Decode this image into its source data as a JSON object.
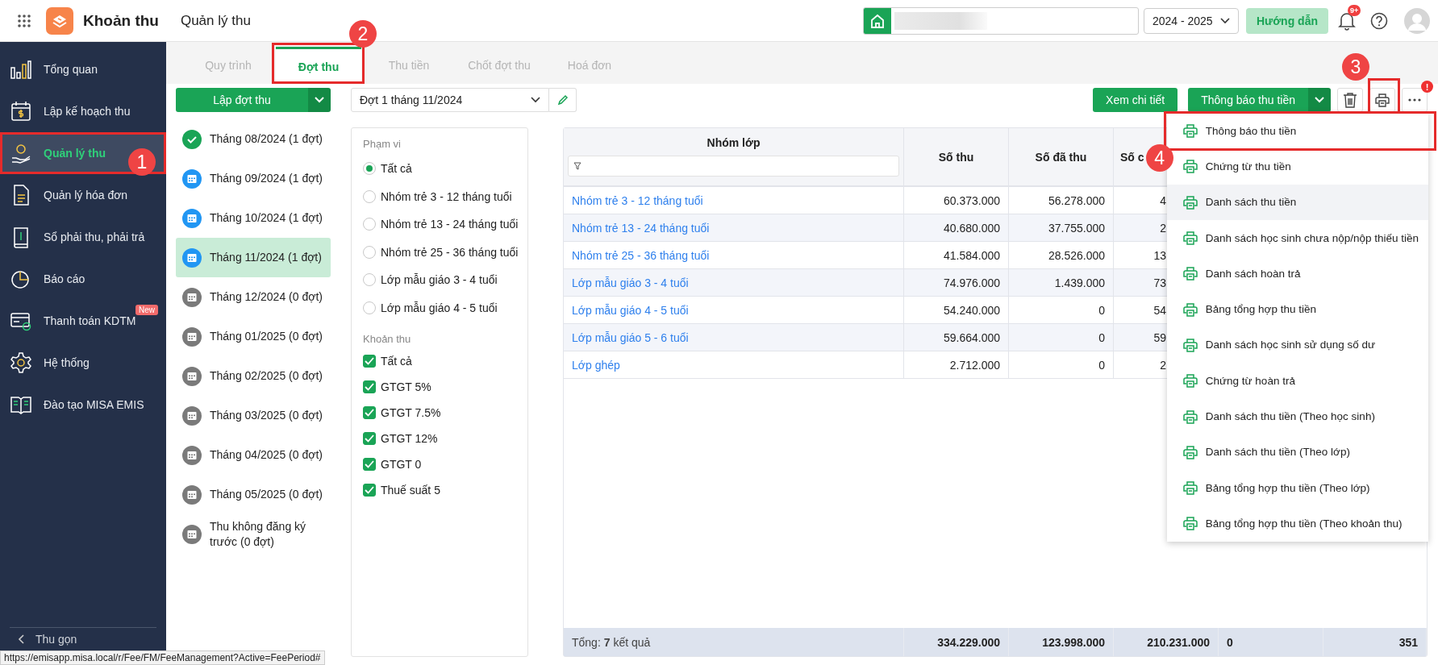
{
  "app": {
    "title": "Khoản thu",
    "page_title": "Quản lý thu"
  },
  "header": {
    "year": "2024 - 2025",
    "guide_button": "Hướng dẫn",
    "notification_badge": "9+"
  },
  "sidebar": {
    "items": [
      {
        "label": "Tổng quan",
        "kind": "chart",
        "selected": false
      },
      {
        "label": "Lập kế hoạch thu",
        "kind": "calendar",
        "selected": false
      },
      {
        "label": "Quản lý thu",
        "kind": "hand",
        "selected": true,
        "callout": "1"
      },
      {
        "label": "Quản lý hóa đơn",
        "kind": "document",
        "selected": false
      },
      {
        "label": "Sổ phải thu, phải trả",
        "kind": "ledger",
        "selected": false
      },
      {
        "label": "Báo cáo",
        "kind": "pie",
        "selected": false
      },
      {
        "label": "Thanh toán KDTM",
        "kind": "card",
        "selected": false,
        "badge": "New"
      },
      {
        "label": "Hệ thống",
        "kind": "gear",
        "selected": false
      },
      {
        "label": "Đào tạo MISA EMIS",
        "kind": "book",
        "selected": false
      }
    ],
    "collapse": "Thu gọn"
  },
  "tabs": [
    {
      "label": "Quy trình",
      "selected": false
    },
    {
      "label": "Đợt thu",
      "selected": true,
      "callout": "2"
    },
    {
      "label": "Thu tiền",
      "selected": false
    },
    {
      "label": "Chốt đợt thu",
      "selected": false
    },
    {
      "label": "Hoá đơn",
      "selected": false
    }
  ],
  "periods": {
    "create_button": "Lập đợt thu",
    "months": [
      {
        "label": "Tháng 08/2024 (1 đợt)",
        "kind": "done",
        "selected": false
      },
      {
        "label": "Tháng 09/2024 (1 đợt)",
        "kind": "scheduled",
        "selected": false
      },
      {
        "label": "Tháng 10/2024 (1 đợt)",
        "kind": "scheduled",
        "selected": false
      },
      {
        "label": "Tháng 11/2024 (1 đợt)",
        "kind": "scheduled",
        "selected": true
      },
      {
        "label": "Tháng 12/2024 (0 đợt)",
        "kind": "empty",
        "selected": false
      },
      {
        "label": "Tháng 01/2025 (0 đợt)",
        "kind": "empty",
        "selected": false
      },
      {
        "label": "Tháng 02/2025 (0 đợt)",
        "kind": "empty",
        "selected": false
      },
      {
        "label": "Tháng 03/2025 (0 đợt)",
        "kind": "empty",
        "selected": false
      },
      {
        "label": "Tháng 04/2025 (0 đợt)",
        "kind": "empty",
        "selected": false
      },
      {
        "label": "Tháng 05/2025 (0 đợt)",
        "kind": "empty",
        "selected": false
      },
      {
        "label": "Thu không đăng ký trước (0 đợt)",
        "kind": "empty",
        "selected": false
      }
    ]
  },
  "period_select": {
    "value": "Đợt 1 tháng 11/2024"
  },
  "actions": {
    "detail_button": "Xem chi tiết",
    "notify_button": "Thông báo thu tiền",
    "print_callout": "3",
    "more_alert": "!"
  },
  "filters": {
    "scope_label": "Phạm vi",
    "scope": [
      {
        "label": "Tất cả",
        "selected": true
      },
      {
        "label": "Nhóm trẻ 3 - 12 tháng tuổi",
        "selected": false
      },
      {
        "label": "Nhóm trẻ 13 - 24 tháng tuổi",
        "selected": false
      },
      {
        "label": "Nhóm trẻ 25 - 36 tháng tuổi",
        "selected": false
      },
      {
        "label": "Lớp mẫu giáo 3 - 4 tuổi",
        "selected": false
      },
      {
        "label": "Lớp mẫu giáo 4 - 5 tuổi",
        "selected": false
      }
    ],
    "fee_label": "Khoản thu",
    "fees": [
      {
        "label": "Tất cả",
        "checked": true
      },
      {
        "label": "GTGT 5%",
        "checked": true
      },
      {
        "label": "GTGT 7.5%",
        "checked": true
      },
      {
        "label": "GTGT 12%",
        "checked": true
      },
      {
        "label": "GTGT 0",
        "checked": true
      },
      {
        "label": "Thuế suất 5",
        "checked": true
      }
    ]
  },
  "table": {
    "columns": [
      "Nhóm lớp",
      "Số thu",
      "Số đã thu",
      "Số c"
    ],
    "rows": [
      {
        "cells": [
          "Nhóm trẻ 3 - 12 tháng tuổi",
          "60.373.000",
          "56.278.000",
          "4"
        ]
      },
      {
        "cells": [
          "Nhóm trẻ 13 - 24 tháng tuổi",
          "40.680.000",
          "37.755.000",
          "2"
        ]
      },
      {
        "cells": [
          "Nhóm trẻ 25 - 36 tháng tuổi",
          "41.584.000",
          "28.526.000",
          "13"
        ]
      },
      {
        "cells": [
          "Lớp mẫu giáo 3 - 4 tuổi",
          "74.976.000",
          "1.439.000",
          "73"
        ]
      },
      {
        "cells": [
          "Lớp mẫu giáo 4 - 5 tuổi",
          "54.240.000",
          "0",
          "54"
        ]
      },
      {
        "cells": [
          "Lớp mẫu giáo 5 - 6 tuổi",
          "59.664.000",
          "0",
          "59"
        ]
      },
      {
        "cells": [
          "Lớp ghép",
          "2.712.000",
          "0",
          "2"
        ]
      }
    ],
    "footer": {
      "label": "Tổng: **7** kết quả",
      "totals": [
        "334.229.000",
        "123.998.000",
        "210.231.000",
        "0",
        "351"
      ]
    }
  },
  "print_menu": {
    "items": [
      {
        "label": "Thông báo thu tiền",
        "hovered": false,
        "callout": "4"
      },
      {
        "label": "Chứng từ thu tiền",
        "hovered": false
      },
      {
        "label": "Danh sách thu tiền",
        "hovered": true
      },
      {
        "label": "Danh sách học sinh chưa nộp/nộp thiếu tiền",
        "hovered": false
      },
      {
        "label": "Danh sách hoàn trả",
        "hovered": false
      },
      {
        "label": "Bảng tổng hợp thu tiền",
        "hovered": false
      },
      {
        "label": "Danh sách học sinh sử dụng số dư",
        "hovered": false
      },
      {
        "label": "Chứng từ hoàn trả",
        "hovered": false
      },
      {
        "label": "Danh sách thu tiền (Theo học sinh)",
        "hovered": false
      },
      {
        "label": "Danh sách thu tiền (Theo lớp)",
        "hovered": false
      },
      {
        "label": "Bảng tổng hợp thu tiền (Theo lớp)",
        "hovered": false
      },
      {
        "label": "Bảng tổng hợp thu tiền (Theo khoản thu)",
        "hovered": false
      }
    ]
  },
  "status_url": "https://emisapp.misa.local/r/Fee/FM/FeeManagement?Active=FeePeriod#"
}
